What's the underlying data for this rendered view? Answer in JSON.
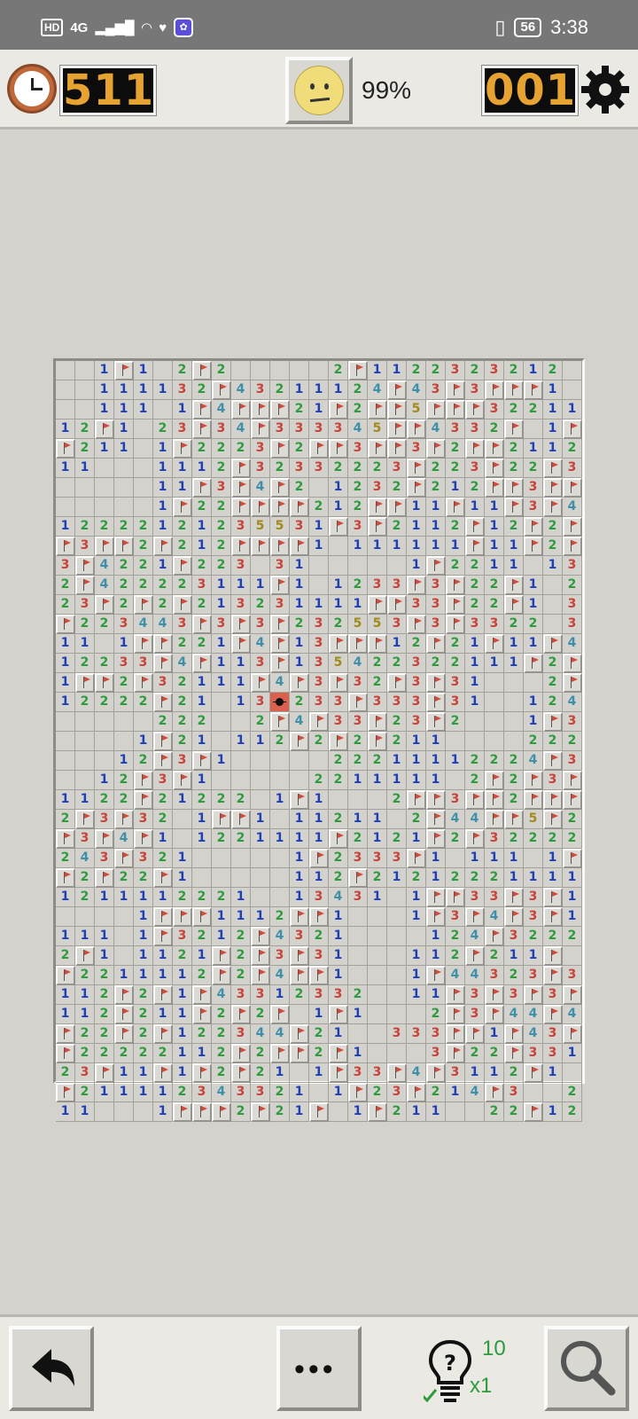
{
  "status_bar": {
    "hd": "HD",
    "net": "4G",
    "battery": "56",
    "time": "3:38"
  },
  "top_bar": {
    "timer": "511",
    "progress": "99%",
    "mines_left": "001"
  },
  "bottom_bar": {
    "hint_count": "10",
    "hint_multiplier": "x1"
  },
  "board": {
    "cols": 27,
    "rows": [
      "..1F1.2F2.....2F1122323212..",
      "..111132F43211124F43F3FFF1..",
      "..111.1F4FFF21F2FF5FFF322111",
      "12F1.23F34F333345FF4332F.1F1",
      "F211.1F2223F2FF3FF3F2FF21122",
      "11...1112F32332223F223F22F3F",
      ".....11F3F4F2.1232F212FF3FFF",
      ".....1F22FFFF212FF11F11F3F42",
      "12222121235531F3F2112F12F2F4",
      "F3FF2F212FFFF1.111111F11F2FF",
      "3F4221F223.31.....1F2211.133",
      "2F422223111F1.1233F3F22F1.2F",
      "23F2F2F213231111FF33F22F1.3F",
      "F223443F3F3F232553F3F3322.3F",
      "11.1FF221F4F13FFF12F21F11F4F",
      "12233F4F113F135422322111F2FF",
      "1FF2F32111F4F3F32F3F31...2F4",
      "12222F21.13F233F333F31..124F",
      ".....222..2F4F33F23F2...1F3F",
      "....1F21.112F2F2F211....2223",
      "...12F3F1.....22211112224F31",
      "..12F3F1.....2211111.2F2F3F1",
      "1122F21222.1F1...2FF3FF2FFF2",
      "2F3F32.1FF1.11211.2F44FF5F2",
      "F3F4F1.1221111F2121F2F32222",
      "243F321.....1F2333F1.111.1F",
      "F2F22F1.....112F2121222111111",
      "1211112221..13431.1FF33F3F11",
      "....1FFF1112FF1...1F3F4F3F1",
      "111.1F3212F4321....124F3222",
      "2F1.1121F2F3F31...112F211F",
      "F2211112F2F4FF1...1F44323F3",
      "112F2F1F43312332..11F3F3F3F2",
      "112F211F2F2F.1F1...2F3F44F431",
      "F22F2F122344F21..333FF1F43F21",
      "F22222112F2FF2F1...3F22F331.",
      "23F11F1F2F21.1F33F4F3112F1",
      "F211112343321.1F23F214F3..2F",
      "11...1FFF2F21F.1F211..22F12F"
    ]
  }
}
